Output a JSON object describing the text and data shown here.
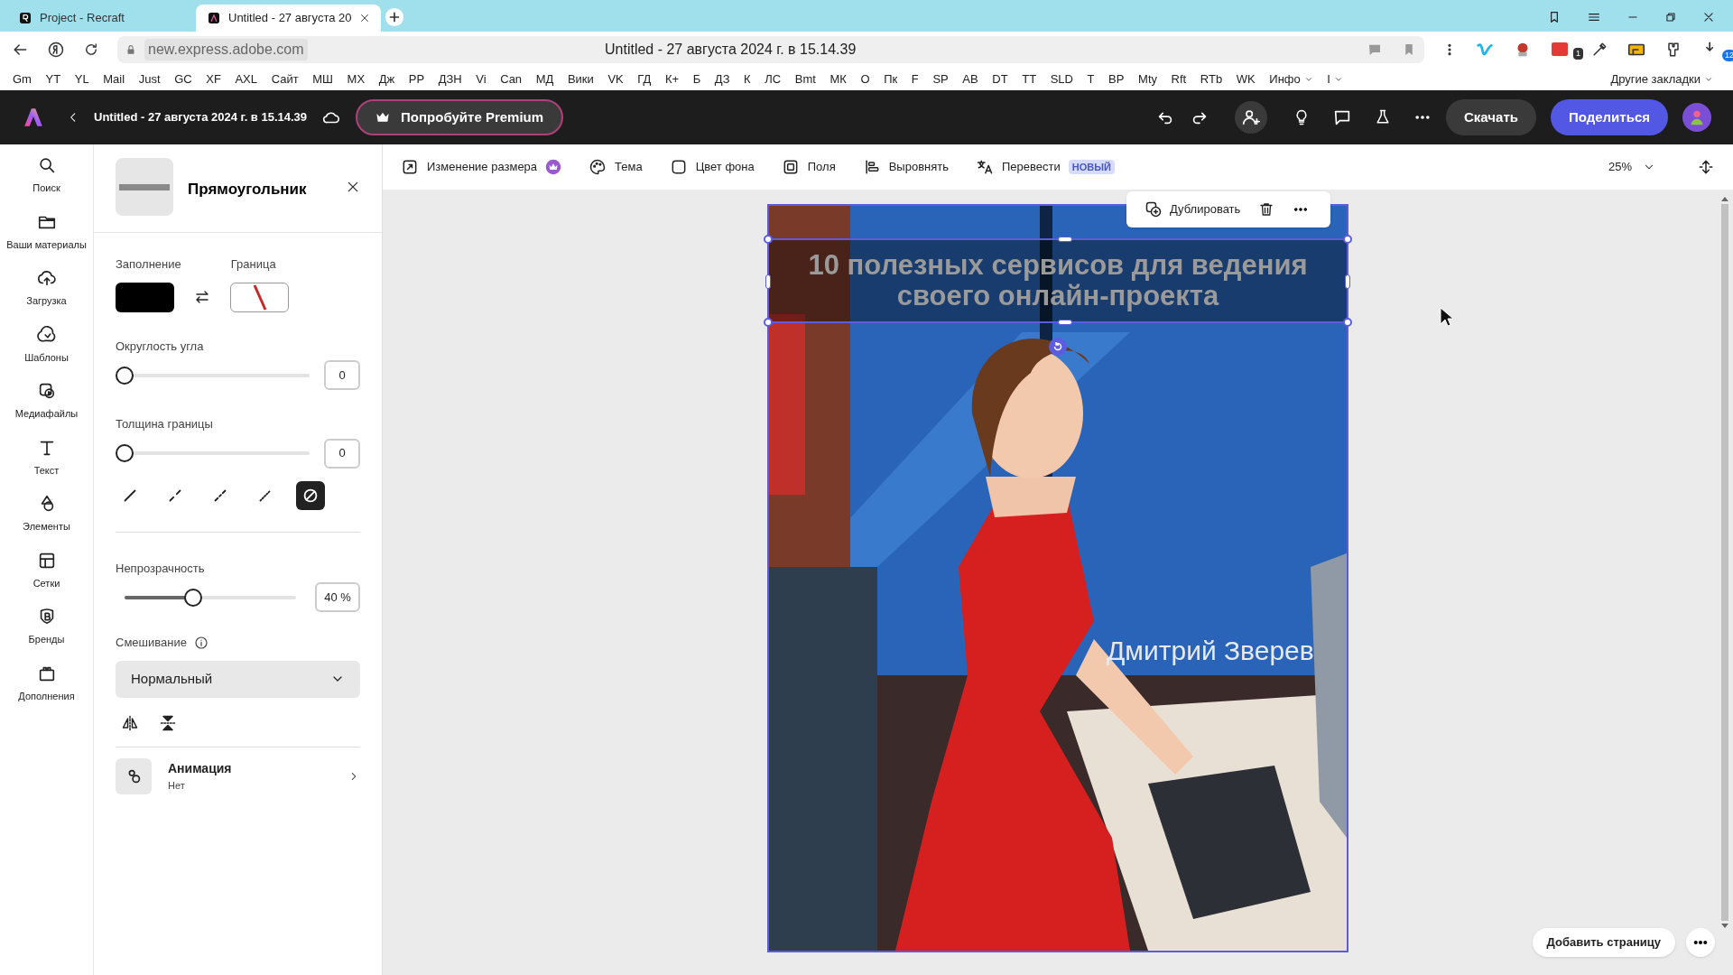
{
  "browser": {
    "tabs": [
      {
        "title": "Project - Recraft",
        "selected": false
      },
      {
        "title": "Untitled - 27 августа 20",
        "selected": true
      }
    ],
    "address": "new.express.adobe.com",
    "page_title": "Untitled - 27 августа 2024 г. в 15.14.39",
    "extension_badges": [
      "1",
      "12"
    ],
    "bookmarks": [
      {
        "label": "Gm"
      },
      {
        "label": "YT"
      },
      {
        "label": "YL"
      },
      {
        "label": "Mail"
      },
      {
        "label": "Just"
      },
      {
        "label": "GC"
      },
      {
        "label": "XF"
      },
      {
        "label": "AXL"
      },
      {
        "label": "Сайт"
      },
      {
        "label": "МШ"
      },
      {
        "label": "МХ"
      },
      {
        "label": "Дж"
      },
      {
        "label": "РР"
      },
      {
        "label": "ДЗН"
      },
      {
        "label": "Vi"
      },
      {
        "label": "Can"
      },
      {
        "label": "МД"
      },
      {
        "label": "Вики"
      },
      {
        "label": "VK"
      },
      {
        "label": "ГД"
      },
      {
        "label": "К+"
      },
      {
        "label": "Б"
      },
      {
        "label": "ДЗ"
      },
      {
        "label": "К"
      },
      {
        "label": "ЛС"
      },
      {
        "label": "Bmt"
      },
      {
        "label": "МК"
      },
      {
        "label": "О"
      },
      {
        "label": "Пк"
      },
      {
        "label": "F"
      },
      {
        "label": "SP"
      },
      {
        "label": "AB"
      },
      {
        "label": "DT"
      },
      {
        "label": "TT"
      },
      {
        "label": "SLD"
      },
      {
        "label": "T"
      },
      {
        "label": "BP"
      },
      {
        "label": "Mty"
      },
      {
        "label": "Rft"
      },
      {
        "label": "RTb"
      },
      {
        "label": "WK"
      },
      {
        "label": "Инфо",
        "folder": true
      },
      {
        "label": "I",
        "folder": true
      }
    ],
    "other_bookmarks": "Другие закладки"
  },
  "app_header": {
    "doc_title": "Untitled - 27 августа 2024 г. в 15.14.39",
    "premium": "Попробуйте Premium",
    "download": "Скачать",
    "share": "Поделиться"
  },
  "rail": [
    {
      "kind": "search",
      "label": "Поиск"
    },
    {
      "kind": "folder",
      "label": "Ваши материалы"
    },
    {
      "kind": "upload",
      "label": "Загрузка"
    },
    {
      "kind": "templates",
      "label": "Шаблоны"
    },
    {
      "kind": "media",
      "label": "Медиафайлы"
    },
    {
      "kind": "text",
      "label": "Текст"
    },
    {
      "kind": "shapes",
      "label": "Элементы"
    },
    {
      "kind": "grid",
      "label": "Сетки"
    },
    {
      "kind": "brand",
      "label": "Бренды"
    },
    {
      "kind": "addons",
      "label": "Дополнения"
    }
  ],
  "panel": {
    "title": "Прямоугольник",
    "fill_label": "Заполнение",
    "border_label": "Граница",
    "sliders": [
      {
        "label": "Округлость угла",
        "level": 0,
        "value": "0"
      },
      {
        "label": "Толщина границы",
        "level": 0,
        "value": "0"
      }
    ],
    "stroke_styles": [
      {
        "kind": "solid",
        "selected": false
      },
      {
        "kind": "dashed",
        "selected": false
      },
      {
        "kind": "dash-dot",
        "selected": false
      },
      {
        "kind": "dotted",
        "selected": false
      },
      {
        "kind": "none",
        "selected": true
      }
    ],
    "opacity": {
      "label": "Непрозрачность",
      "level": 0.4,
      "value": "40 %"
    },
    "blend": {
      "label": "Смешивание",
      "value": "Нормальный"
    },
    "animation": {
      "title": "Анимация",
      "value": "Нет"
    }
  },
  "toolbar": [
    {
      "kind": "resize",
      "label": "Изменение размера",
      "premium": true
    },
    {
      "kind": "theme",
      "label": "Тема"
    },
    {
      "kind": "background",
      "label": "Цвет фона"
    },
    {
      "kind": "margins",
      "label": "Поля"
    },
    {
      "kind": "align",
      "label": "Выровнять"
    },
    {
      "kind": "translate",
      "label": "Перевести",
      "badge": "НОВЫЙ"
    }
  ],
  "zoom": "25%",
  "canvas": {
    "headline": "10 полезных сервисов для ведения своего онлайн-проекта",
    "author": "Дмитрий Зверев",
    "duplicate": "Дублировать",
    "add_page": "Добавить страницу"
  }
}
